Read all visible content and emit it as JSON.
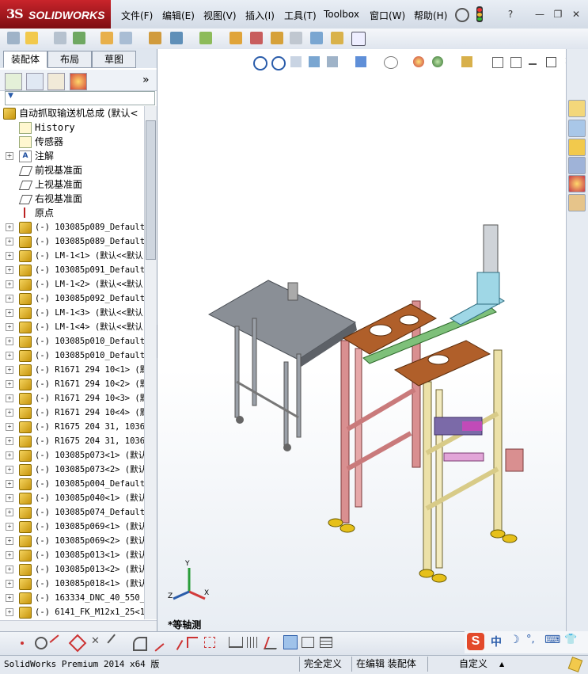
{
  "app": {
    "logo_ds": "3S",
    "logo_name": "SOLIDWORKS"
  },
  "menu": [
    "文件(F)",
    "编辑(E)",
    "视图(V)",
    "插入(I)",
    "工具(T)",
    "Toolbox",
    "窗口(W)",
    "帮助(H)"
  ],
  "window_controls": {
    "help": "?",
    "minimize": "—",
    "restore": "❐",
    "close": "✕"
  },
  "tabs": [
    "装配体",
    "布局",
    "草图"
  ],
  "panel": {
    "expand": "»",
    "filter": "▼"
  },
  "tree": {
    "root": "自动抓取输送机总成  (默认<",
    "features": [
      {
        "label": "History",
        "icon": "history-icon"
      },
      {
        "label": "传感器",
        "icon": "sensor-icon"
      },
      {
        "label": "注解",
        "icon": "annotation-icon"
      },
      {
        "label": "前视基准面",
        "icon": "plane-icon"
      },
      {
        "label": "上视基准面",
        "icon": "plane-icon"
      },
      {
        "label": "右视基准面",
        "icon": "plane-icon"
      },
      {
        "label": "原点",
        "icon": "origin-icon"
      }
    ],
    "components": [
      "(-) 103085p089_Default_",
      "(-) 103085p089_Default_",
      "(-) LM-1<1> (默认<<默认",
      "(-) 103085p091_Default_",
      "(-) LM-1<2> (默认<<默认",
      "(-) 103085p092_Default_",
      "(-) LM-1<3> (默认<<默认",
      "(-) LM-1<4> (默认<<默认",
      "(-) 103085p010_Default_",
      "(-) 103085p010_Default_",
      "(-) R1671 294 10<1> (默",
      "(-) R1671 294 10<2> (默",
      "(-) R1671 294 10<3> (默",
      "(-) R1671 294 10<4> (默",
      "(-) R1675 204 31, 1036<",
      "(-) R1675 204 31, 1036<",
      "(-) 103085p073<1> (默认",
      "(-) 103085p073<2> (默认",
      "(-) 103085p004_Default_",
      "(-) 103085p040<1> (默认",
      "(-) 103085p074_Default_",
      "(-) 103085p069<1> (默认",
      "(-) 103085p069<2> (默认",
      "(-) 103085p013<1> (默认",
      "(-) 103085p013<2> (默认",
      "(-) 103085p018<1> (默认",
      "(-) 163334_DNC_40_550_P",
      "(-) 6141_FK_M12x1_25<1>"
    ]
  },
  "viewport": {
    "view_name": "*等轴测",
    "triad": {
      "x": "X",
      "y": "Y",
      "z": "Z"
    }
  },
  "status": {
    "product": "SolidWorks Premium 2014 x64 版",
    "definition": "完全定义",
    "mode": "在编辑 装配体",
    "units": "自定义",
    "units_arrow": "▲"
  },
  "ime": {
    "logo": "S",
    "lang": "中",
    "moon": "☽",
    "punct": "°,",
    "keyboard": "⌨",
    "shirt": "👕"
  },
  "colors": {
    "brand": "#c9242b",
    "accent": "#2a5caa"
  }
}
